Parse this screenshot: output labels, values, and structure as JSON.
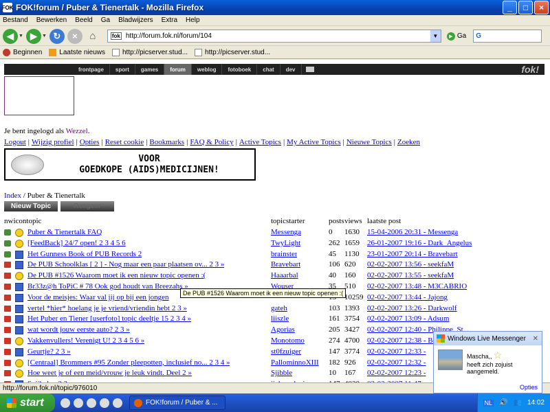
{
  "window": {
    "title": "FOK!forum / Puber & Tienertalk - Mozilla Firefox",
    "app_icon": "FOK"
  },
  "menu": [
    "Bestand",
    "Bewerken",
    "Beeld",
    "Ga",
    "Bladwijzers",
    "Extra",
    "Help"
  ],
  "nav": {
    "url": "http://forum.fok.nl/forum/104",
    "go_label": "Ga",
    "search_placeholder": "G"
  },
  "bookmarks": [
    {
      "label": "Beginnen",
      "icon": "firefox-icon"
    },
    {
      "label": "Laatste nieuws",
      "icon": "rss-icon"
    },
    {
      "label": "http://picserver.stud...",
      "icon": "page-icon"
    },
    {
      "label": "http://picserver.stud...",
      "icon": "page-icon"
    }
  ],
  "site": {
    "nav": [
      "frontpage",
      "sport",
      "games",
      "forum",
      "weblog",
      "fotoboek",
      "chat",
      "dev"
    ],
    "active_nav": "forum",
    "logo": "fok!",
    "logged_in_prefix": "Je bent ingelogd als ",
    "username": "Wezzel",
    "logged_in_suffix": ".",
    "links": [
      "Logout",
      "Wijzig profiel",
      "Opties",
      "Reset cookie",
      "Bookmarks",
      "FAQ & Policy",
      "Active Topics",
      "My Active Topics",
      "Nieuwe Topics",
      "Zoeken"
    ],
    "ad_line1": "VOOR",
    "ad_line2": "GOEDKOPE (AIDS)MEDICIJNEN!",
    "crumb_index": "Index",
    "crumb_forum": " / Puber & Tienertalk",
    "new_topic": "Nieuw Topic",
    "reply": "Reageer",
    "headers": {
      "nwicon": "nwicontopic",
      "starter": "topicstarter",
      "posts": "posts",
      "views": "views",
      "last": "laatste post"
    },
    "topics": [
      {
        "icon1": "pin",
        "icon2": "smile",
        "title": "Puber & Tienertalk FAQ",
        "starter": "Messenga",
        "posts": "0",
        "views": "1630",
        "last": "15-04-2006 20:31 - Messenga"
      },
      {
        "icon1": "pin",
        "icon2": "smile",
        "title": "[FeedBack] 24/7 open! 2 3 4 5 6",
        "starter": "TwyLight",
        "posts": "262",
        "views": "1659",
        "last": "26-01-2007 19:16 - Dark_Angelus"
      },
      {
        "icon1": "pin",
        "icon2": "doc",
        "title": "Het Gunness Book of PUB Records 2",
        "starter": "brainster",
        "posts": "45",
        "views": "1130",
        "last": "23-01-2007 20:14 - Bravebart"
      },
      {
        "icon1": "folder",
        "icon2": "doc",
        "title": "De PUB Schoolklas [ 2 ] - Nog maar een paar plaatsen ov... 2 3 »",
        "starter": "Bravebart",
        "posts": "106",
        "views": "620",
        "last": "02-02-2007 13:56 - seekfaM"
      },
      {
        "icon1": "folder",
        "icon2": "smile",
        "title": "De PUB #1526 Waarom moet ik een nieuw topic openen :(",
        "starter": "Haaarbal",
        "posts": "40",
        "views": "160",
        "last": "02-02-2007 13:55 - seekfaM"
      },
      {
        "icon1": "folder",
        "icon2": "doc",
        "title": "Br33z@h ToPiC # 78 Ook god houdt van Breezahs »",
        "starter": "Wouser",
        "posts": "35",
        "views": "510",
        "last": "02-02-2007 13:48 - M3CABRIO"
      },
      {
        "icon1": "folder",
        "icon2": "doc",
        "title": "Voor de meisjes: Waar val jij op bij een jongen",
        "starter": "",
        "posts": "13",
        "views": "10259",
        "last": "02-02-2007 13:44 - Jajong"
      },
      {
        "icon1": "folder",
        "icon2": "doc",
        "title": "vertel *hier* hoelang je je vriend/vriendin hebt 2 3 »",
        "starter": "gateh",
        "posts": "103",
        "views": "1393",
        "last": "02-02-2007 13:26 - Darkwolf"
      },
      {
        "icon1": "folder",
        "icon2": "doc",
        "title": "Het Puber en Tiener [userfoto] topic deeltje 15 2 3 4 »",
        "starter": "liiszle",
        "posts": "161",
        "views": "3754",
        "last": "02-02-2007 13:09 - Adsum"
      },
      {
        "icon1": "folder",
        "icon2": "doc",
        "title": "wat wordt jouw eerste auto? 2 3 »",
        "starter": "Agorias",
        "posts": "205",
        "views": "3427",
        "last": "02-02-2007 12:40 - Philippe_St..."
      },
      {
        "icon1": "folder",
        "icon2": "smile",
        "title": "Vakkenvullers! Verenigt U! 2 3 4 5 6 »",
        "starter": "Monotomo",
        "posts": "274",
        "views": "4700",
        "last": "02-02-2007 12:38 - Bozelli"
      },
      {
        "icon1": "folder",
        "icon2": "doc",
        "title": "Geurtje? 2 3 »",
        "starter": "st0fzuiger",
        "posts": "147",
        "views": "3774",
        "last": "02-02-2007 12:33 -"
      },
      {
        "icon1": "folder",
        "icon2": "smile",
        "title": "[Centraal] Brommers #95 Zonder pleepotten, inclusief no... 2 3 4 »",
        "starter": "PallominnoXIII",
        "posts": "182",
        "views": "926",
        "last": "02-02-2007 12:32 -"
      },
      {
        "icon1": "folder",
        "icon2": "smile",
        "title": "Hoe weet je of een meid/vrouw je leuk vindt. Deel 2 »",
        "starter": "Sjibble",
        "posts": "10",
        "views": "167",
        "last": "02-02-2007 12:23 -"
      },
      {
        "icon1": "folder",
        "icon2": "doc",
        "title": "Snijbelen 2 3 »",
        "starter": "jiebrand_cirson",
        "posts": "147",
        "views": "4020",
        "last": "02-02-2007 11:47 -"
      }
    ],
    "tooltip": "De PUB #1526 Waarom moet ik een nieuw topic openen :("
  },
  "status": "http://forum.fok.nl/topic/976010",
  "taskbar": {
    "start": "start",
    "task": "FOK!forum / Puber & ...",
    "lang": "NL",
    "clock": "14:02"
  },
  "messenger": {
    "title": "Windows Live Messenger",
    "line1": "Mascha,,",
    "line2": "heeft zich zojuist",
    "line3": "aangemeld.",
    "options": "Opties"
  },
  "colors": {
    "link": "#0000ff",
    "visited": "#800080",
    "titlebar": "#0842b0"
  }
}
